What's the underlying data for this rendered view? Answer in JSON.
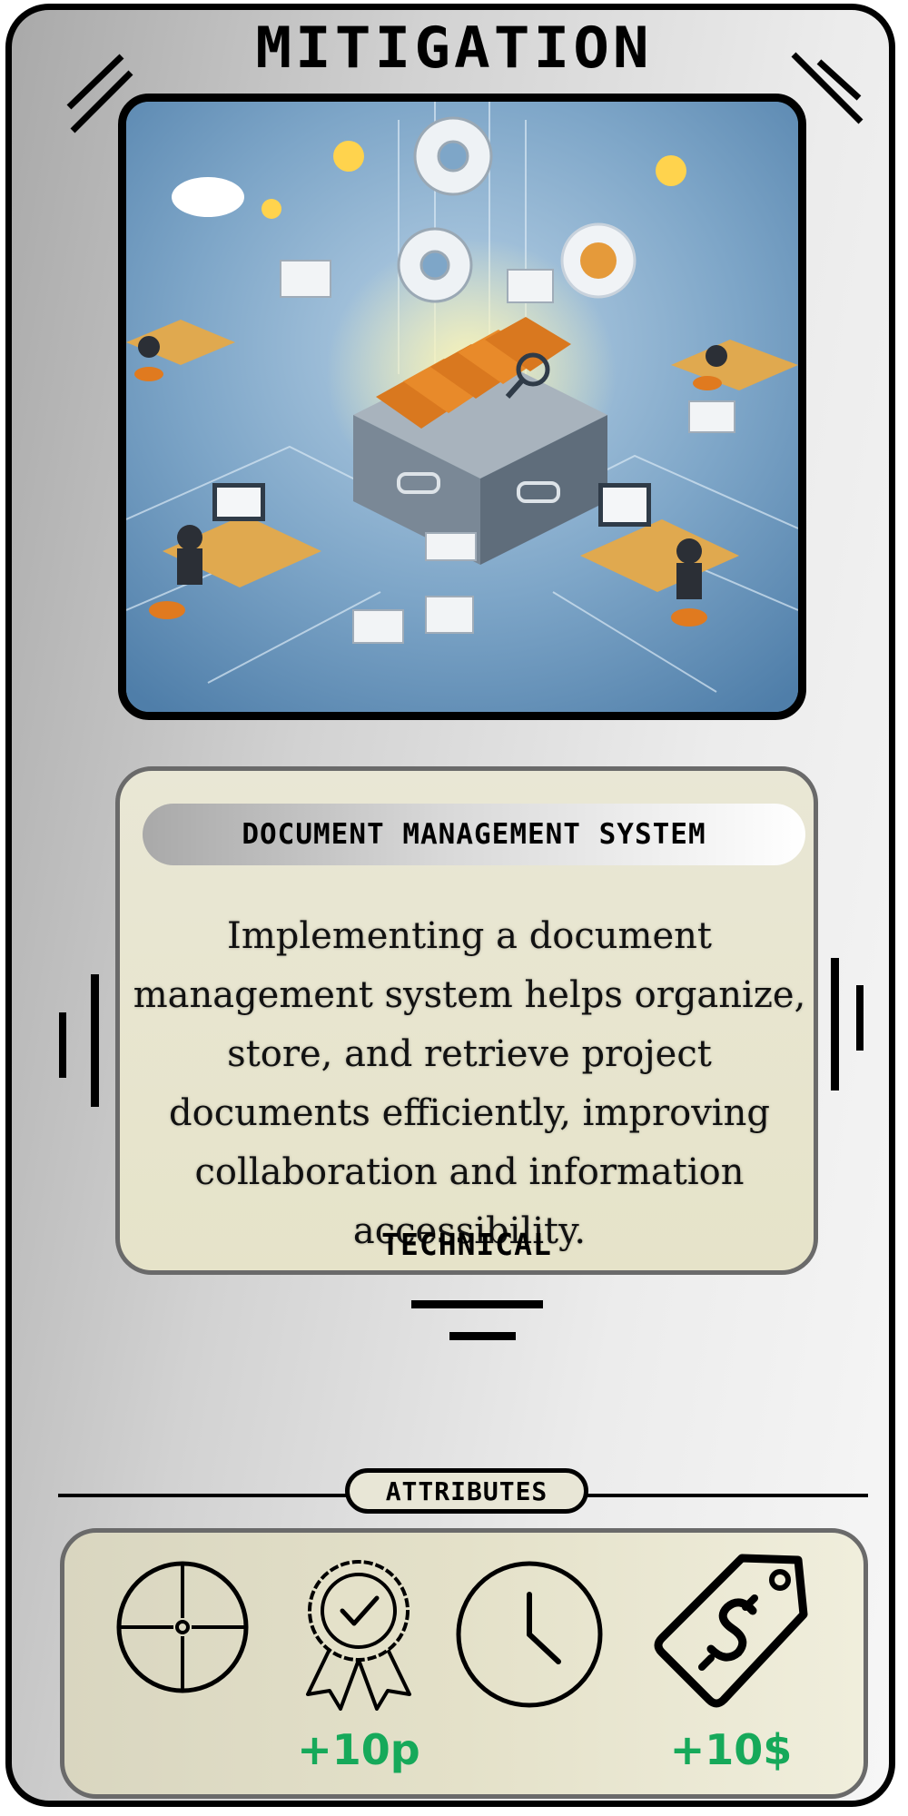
{
  "card": {
    "type_title": "MITIGATION",
    "name": "DOCUMENT MANAGEMENT SYSTEM",
    "description": "Implementing a document management system helps organize, store, and retrieve project documents efficiently, improving collaboration and information accessibility.",
    "category": "TECHNICAL"
  },
  "attributes": {
    "label": "ATTRIBUTES",
    "items": [
      {
        "icon": "crosshair-icon",
        "value": ""
      },
      {
        "icon": "award-ribbon-icon",
        "value": "+10p"
      },
      {
        "icon": "clock-icon",
        "value": ""
      },
      {
        "icon": "price-tag-dollar-icon",
        "value": "+10$"
      }
    ]
  },
  "colors": {
    "value_green": "#16a95a",
    "panel_cream": "#e6e3c9",
    "border": "#000000"
  }
}
